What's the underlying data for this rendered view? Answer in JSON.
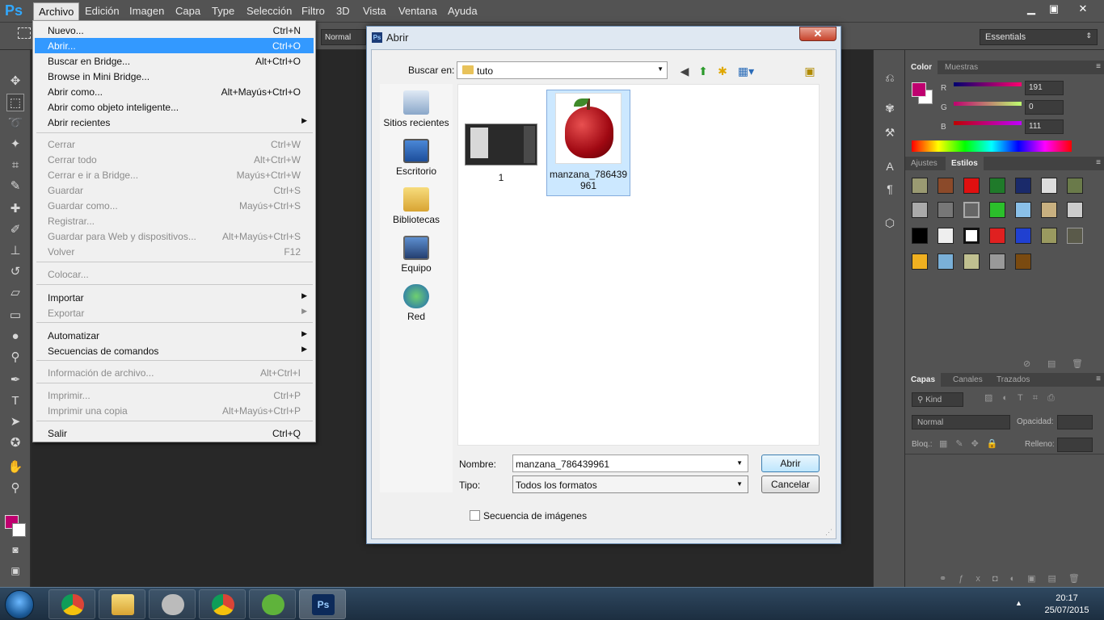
{
  "app": {
    "logo": "Ps"
  },
  "menubar": {
    "items": [
      "Archivo",
      "Edición",
      "Imagen",
      "Capa",
      "Type",
      "Selección",
      "Filtro",
      "3D",
      "Vista",
      "Ventana",
      "Ayuda"
    ],
    "window_buttons": [
      "▁",
      "▣",
      "✕"
    ]
  },
  "options_bar": {
    "blend_mode": "Normal",
    "workspace": "Essentials"
  },
  "file_menu": {
    "items": [
      {
        "label": "Nuevo...",
        "shortcut": "Ctrl+N"
      },
      {
        "label": "Abrir...",
        "shortcut": "Ctrl+O"
      },
      {
        "label": "Buscar en Bridge...",
        "shortcut": "Alt+Ctrl+O"
      },
      {
        "label": "Browse in Mini Bridge...",
        "shortcut": ""
      },
      {
        "label": "Abrir como...",
        "shortcut": "Alt+Mayús+Ctrl+O"
      },
      {
        "label": "Abrir como objeto inteligente...",
        "shortcut": ""
      },
      {
        "label": "Abrir recientes",
        "shortcut": ""
      },
      {
        "label": "Cerrar",
        "shortcut": "Ctrl+W"
      },
      {
        "label": "Cerrar todo",
        "shortcut": "Alt+Ctrl+W"
      },
      {
        "label": "Cerrar e ir a Bridge...",
        "shortcut": "Mayús+Ctrl+W"
      },
      {
        "label": "Guardar",
        "shortcut": "Ctrl+S"
      },
      {
        "label": "Guardar como...",
        "shortcut": "Mayús+Ctrl+S"
      },
      {
        "label": "Registrar...",
        "shortcut": ""
      },
      {
        "label": "Guardar para Web y dispositivos...",
        "shortcut": "Alt+Mayús+Ctrl+S"
      },
      {
        "label": "Volver",
        "shortcut": "F12"
      },
      {
        "label": "Colocar...",
        "shortcut": ""
      },
      {
        "label": "Importar",
        "shortcut": ""
      },
      {
        "label": "Exportar",
        "shortcut": ""
      },
      {
        "label": "Automatizar",
        "shortcut": ""
      },
      {
        "label": "Secuencias de comandos",
        "shortcut": ""
      },
      {
        "label": "Información de archivo...",
        "shortcut": "Alt+Ctrl+I"
      },
      {
        "label": "Imprimir...",
        "shortcut": "Ctrl+P"
      },
      {
        "label": "Imprimir una copia",
        "shortcut": "Alt+Mayús+Ctrl+P"
      },
      {
        "label": "Salir",
        "shortcut": "Ctrl+Q"
      }
    ]
  },
  "dialog": {
    "title": "Abrir",
    "close": "✕",
    "look_in_label": "Buscar en:",
    "look_in_value": "tuto",
    "places": [
      "Sitios recientes",
      "Escritorio",
      "Bibliotecas",
      "Equipo",
      "Red"
    ],
    "files": [
      {
        "name": "1"
      },
      {
        "name": "manzana_786439961"
      }
    ],
    "name_label": "Nombre:",
    "name_value": "manzana_786439961",
    "type_label": "Tipo:",
    "type_value": "Todos los formatos",
    "open_button": "Abrir",
    "cancel_button": "Cancelar",
    "sequence_label": "Secuencia de imágenes"
  },
  "color_panel": {
    "tabs": [
      "Color",
      "Muestras"
    ],
    "r_label": "R",
    "g_label": "G",
    "b_label": "B",
    "r": "191",
    "g": "0",
    "b": "111",
    "foreground": "#bf006f"
  },
  "styles_panel": {
    "tabs": [
      "Ajustes",
      "Estilos"
    ]
  },
  "layers_panel": {
    "tabs": [
      "Capas",
      "Canales",
      "Trazados"
    ],
    "kind": "Kind",
    "blend": "Normal",
    "opacity_label": "Opacidad:",
    "lock_label": "Bloq.:",
    "fill_label": "Relleno:"
  },
  "taskbar": {
    "time": "20:17",
    "date": "25/07/2015"
  }
}
